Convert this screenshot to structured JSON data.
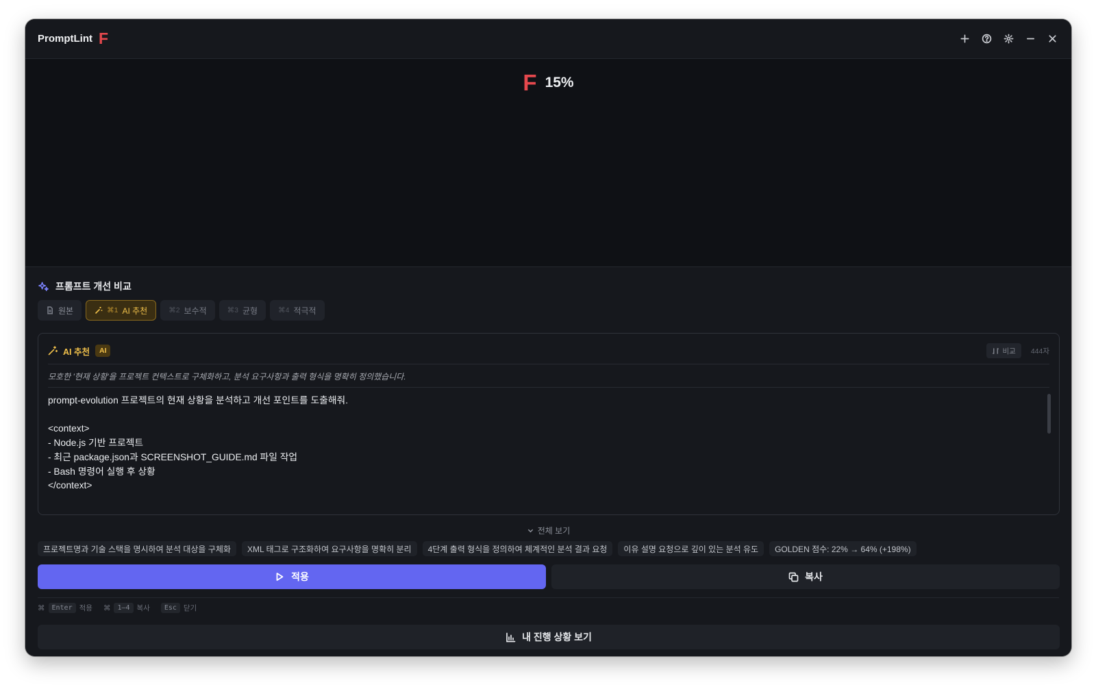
{
  "app": {
    "title": "PromptLint",
    "grade": "F"
  },
  "titlebar": {
    "icons": [
      "plus-icon",
      "help-icon",
      "gear-icon",
      "minimize-icon",
      "close-icon"
    ]
  },
  "score": {
    "grade": "F",
    "percent": "15%"
  },
  "section": {
    "title": "프롬프트 개선 비교",
    "icon": "sparkles-icon"
  },
  "tabs": [
    {
      "kbd": "",
      "label": "원본",
      "icon": "document-icon"
    },
    {
      "kbd": "⌘1",
      "label": "AI 추천",
      "icon": "wand-icon",
      "active": true
    },
    {
      "kbd": "⌘2",
      "label": "보수적"
    },
    {
      "kbd": "⌘3",
      "label": "균형"
    },
    {
      "kbd": "⌘4",
      "label": "적극적"
    }
  ],
  "card": {
    "title": "AI 추천",
    "badge": "AI",
    "compare_label": "비교",
    "char_count": "444자",
    "note": "모호한 '현재 상황'을 프로젝트 컨텍스트로 구체화하고, 분석 요구사항과 출력 형식을 명확히 정의했습니다.",
    "body": "prompt-evolution 프로젝트의 현재 상황을 분석하고 개선 포인트를 도출해줘.\n\n<context>\n- Node.js 기반 프로젝트\n- 최근 package.json과 SCREENSHOT_GUIDE.md 파일 작업\n- Bash 명령어 실행 후 상황\n</context>"
  },
  "expand_label": "전체 보기",
  "chips": [
    "프로젝트명과 기술 스택을 명시하여 분석 대상을 구체화",
    "XML 태그로 구조화하여 요구사항을 명확히 분리",
    "4단계 출력 형식을 정의하여 체계적인 분석 결과 요청",
    "이유 설명 요청으로 깊이 있는 분석 유도",
    "GOLDEN 점수: 22% → 64% (+198%)"
  ],
  "actions": {
    "apply_label": "적용",
    "copy_label": "복사"
  },
  "shortcuts": [
    {
      "mod": "⌘",
      "key": "Enter",
      "label": "적용"
    },
    {
      "mod": "⌘",
      "key": "1–4",
      "label": "복사"
    },
    {
      "mod": "",
      "key": "Esc",
      "label": "닫기"
    }
  ],
  "progress_label": "내 진행 상황 보기",
  "colors": {
    "accent": "#6366f1",
    "grade_fail": "#e5484d",
    "ai_highlight": "#f1c14b",
    "background": "#16181d"
  }
}
